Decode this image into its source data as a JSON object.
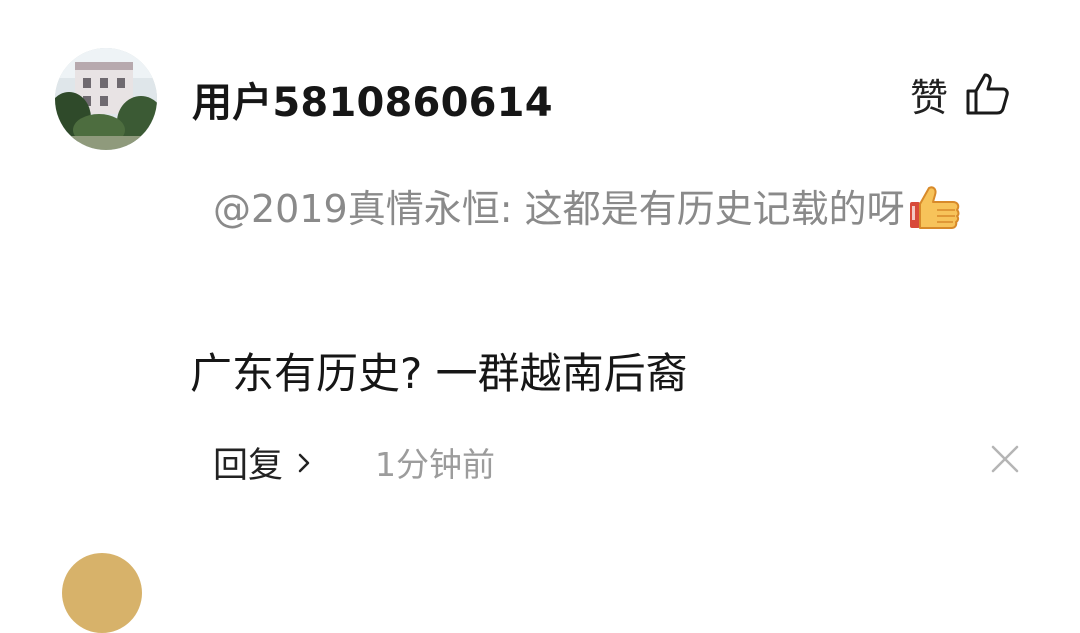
{
  "comment": {
    "username": "用户5810860614",
    "like_label": "赞",
    "quote_text": "@2019真情永恒: 这都是有历史记载的呀",
    "content": "广东有历史? 一群越南后裔",
    "reply_label": "回复",
    "timestamp": "1分钟前"
  },
  "icons": {
    "like": "thumbs-up-outline-icon",
    "quote_emoji": "thumbs-up-emoji-icon",
    "reply_chevron": "chevron-right-icon",
    "close": "close-icon"
  }
}
